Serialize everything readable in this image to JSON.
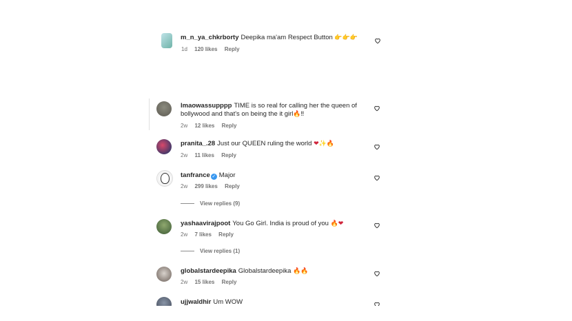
{
  "comments": [
    {
      "user": "m_n_ya_chkrborty",
      "text": "Deepika ma'am Respect Button ",
      "emoji": "👉👉👉",
      "age": "1d",
      "likes": "120 likes",
      "reply": "Reply"
    },
    {
      "user": "lmaowassupppp",
      "text": "TIME is so real for calling her the queen of",
      "text2": "bollywood and that's on being the it girl",
      "emoji": "🔥‼",
      "age": "2w",
      "likes": "12 likes",
      "reply": "Reply"
    },
    {
      "user": "pranita_.28",
      "text": "Just our QUEEN ruling the world ",
      "emoji": "❤✨🔥",
      "age": "2w",
      "likes": "11 likes",
      "reply": "Reply"
    },
    {
      "user": "tanfrance",
      "text": "Major",
      "age": "2w",
      "likes": "299 likes",
      "reply": "Reply",
      "view_replies": "View replies (9)"
    },
    {
      "user": "yashaavirajpoot",
      "text": "You Go Girl. India is proud of you ",
      "emoji": "🔥❤",
      "age": "2w",
      "likes": "7 likes",
      "reply": "Reply",
      "view_replies": "View replies (1)"
    },
    {
      "user": "globalstardeepika",
      "text": "Globalstardeepika ",
      "emoji": "🔥🔥",
      "age": "2w",
      "likes": "15 likes",
      "reply": "Reply"
    },
    {
      "user": "ujjwaldhir",
      "text": "Um WOW"
    }
  ],
  "icons": {
    "like": "heart-outline-icon",
    "verified": "verified-badge-icon"
  }
}
